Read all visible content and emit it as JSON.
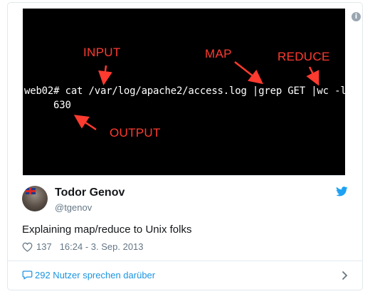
{
  "media": {
    "labels": {
      "input": "INPUT",
      "map": "MAP",
      "reduce": "REDUCE",
      "output": "OUTPUT"
    },
    "command_line": "web02# cat /var/log/apache2/access.log |grep GET |wc -l",
    "output_value": "630",
    "info_icon": "info-icon",
    "label_color": "#ff3b30"
  },
  "author": {
    "display_name": "Todor Genov",
    "handle": "@tgenov",
    "avatar_icon": "avatar"
  },
  "tweet": {
    "text": "Explaining map/reduce to Unix folks",
    "likes": "137",
    "timestamp": "16:24 - 3. Sep. 2013"
  },
  "footer": {
    "replies_label": "292 Nutzer sprechen darüber"
  },
  "colors": {
    "accent": "#1da1f2",
    "link": "#1b95e0",
    "text": "#14171a",
    "muted": "#657786",
    "border": "#e1e8ed"
  }
}
